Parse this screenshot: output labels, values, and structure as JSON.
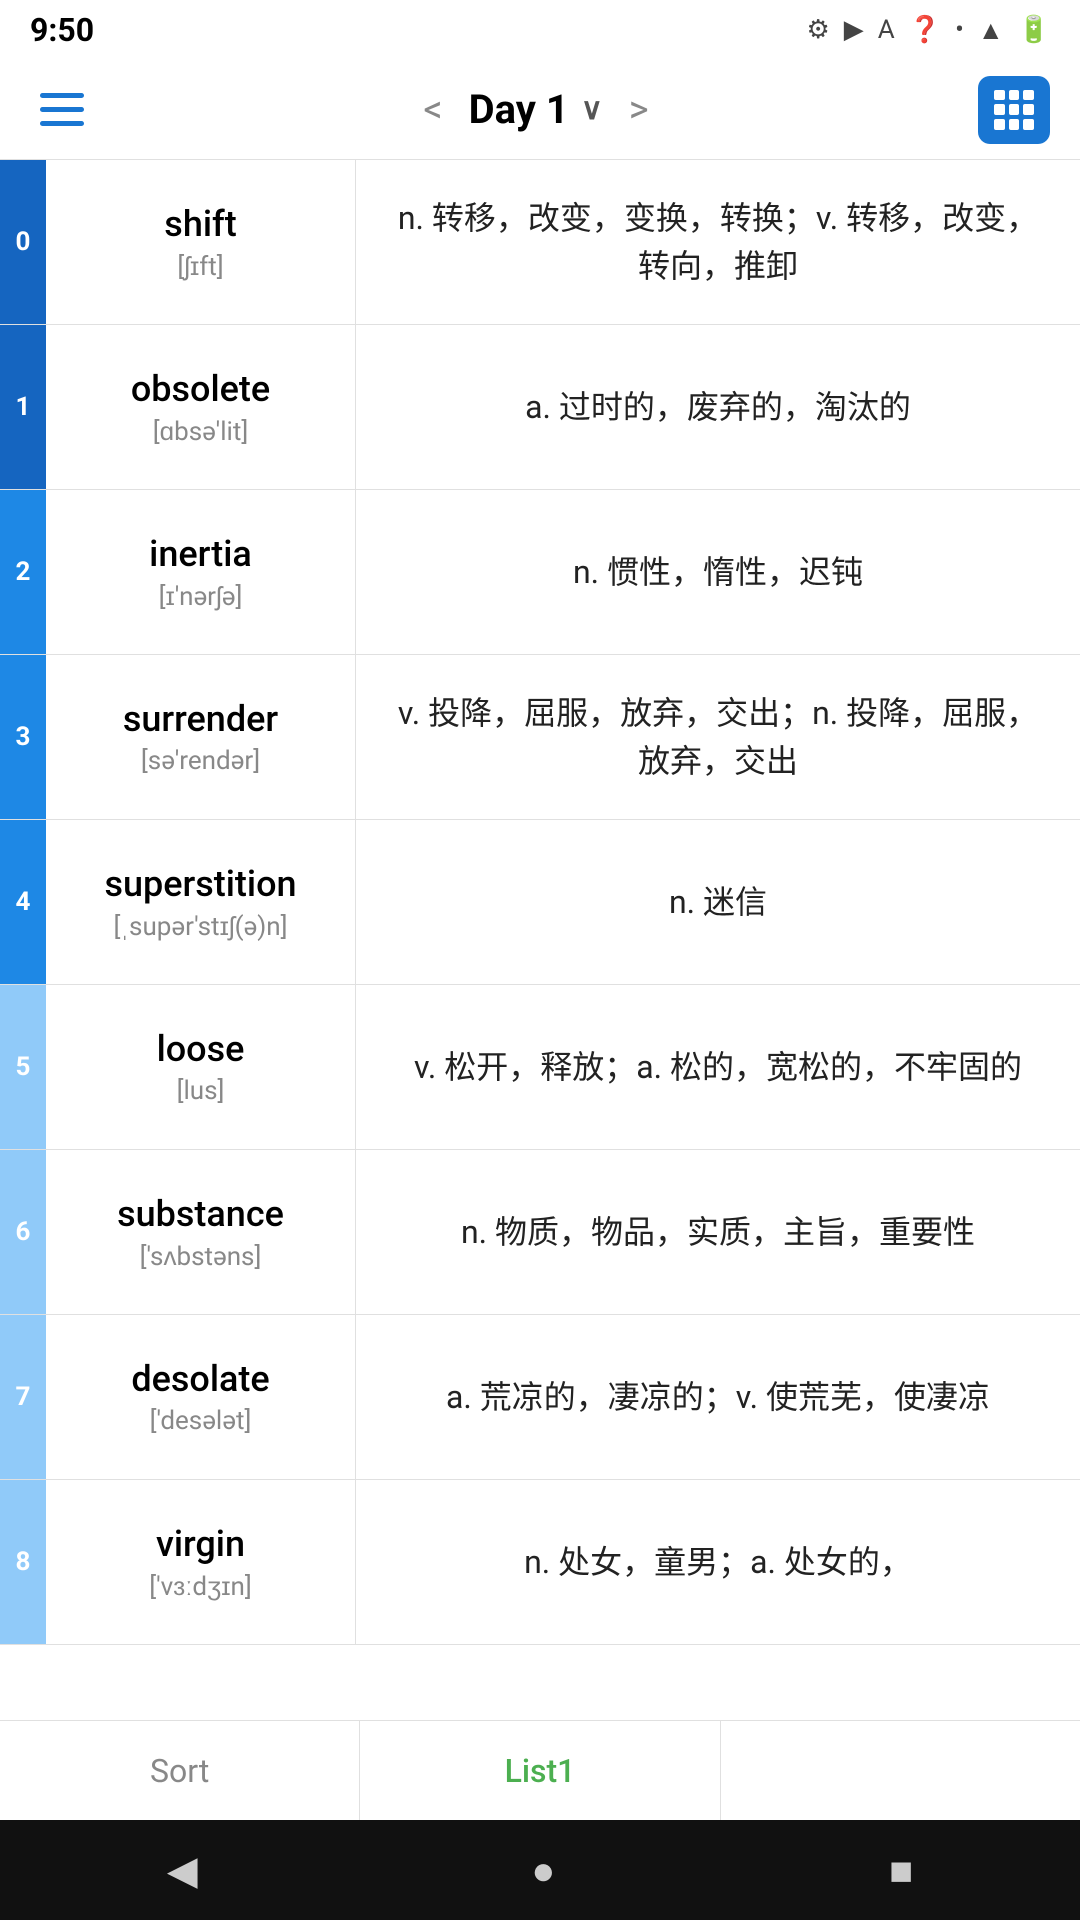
{
  "statusBar": {
    "time": "9:50",
    "icons": [
      "⚙",
      "▶",
      "A",
      "?",
      "•",
      "▲",
      "🔋"
    ]
  },
  "navBar": {
    "title": "Day 1",
    "prevArrow": "<",
    "nextArrow": ">",
    "gridButton": "grid"
  },
  "words": [
    {
      "index": 0,
      "word": "shift",
      "phonetic": "[ʃɪft]",
      "definition": "n. 转移，改变，变换，转换；v. 转移，改变，转向，推卸",
      "colorClass": "blue-dark"
    },
    {
      "index": 1,
      "word": "obsolete",
      "phonetic": "[ɑbsə'lit]",
      "definition": "a. 过时的，废弃的，淘汰的",
      "colorClass": "blue-dark"
    },
    {
      "index": 2,
      "word": "inertia",
      "phonetic": "[ɪ'nərʃə]",
      "definition": "n. 惯性，惰性，迟钝",
      "colorClass": "blue-mid"
    },
    {
      "index": 3,
      "word": "surrender",
      "phonetic": "[sə'rendər]",
      "definition": "v. 投降，屈服，放弃，交出；n. 投降，屈服，放弃，交出",
      "colorClass": "blue-mid"
    },
    {
      "index": 4,
      "word": "superstition",
      "phonetic": "[ˌsupər'stɪʃ(ə)n]",
      "definition": "n. 迷信",
      "colorClass": "blue-mid"
    },
    {
      "index": 5,
      "word": "loose",
      "phonetic": "[lus]",
      "definition": "v. 松开，释放；a. 松的，宽松的，不牢固的",
      "colorClass": "blue-light"
    },
    {
      "index": 6,
      "word": "substance",
      "phonetic": "['sʌbstəns]",
      "definition": "n. 物质，物品，实质，主旨，重要性",
      "colorClass": "blue-light"
    },
    {
      "index": 7,
      "word": "desolate",
      "phonetic": "['desələt]",
      "definition": "a. 荒凉的，凄凉的；v. 使荒芜，使凄凉",
      "colorClass": "blue-light"
    },
    {
      "index": 8,
      "word": "virgin",
      "phonetic": "['vɜːdʒɪn]",
      "definition": "n. 处女，童男；a. 处女的，",
      "colorClass": "blue-light"
    }
  ],
  "bottomTabs": {
    "sortLabel": "Sort",
    "list1Label": "List1"
  },
  "androidNav": {
    "back": "◀",
    "home": "●",
    "recent": "■"
  }
}
